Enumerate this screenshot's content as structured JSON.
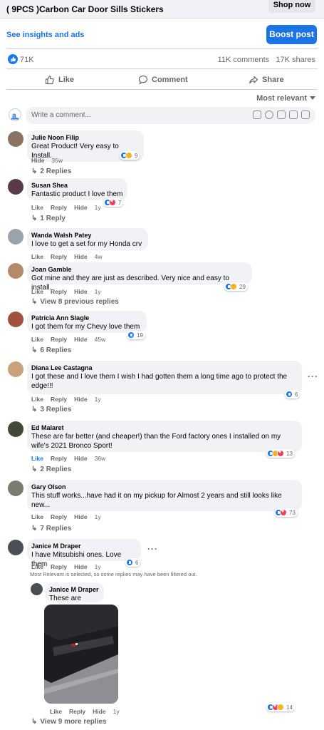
{
  "header": {
    "title": "( 9PCS )Carbon Car Door Sills Stickers",
    "shop_button": "Shop now"
  },
  "promo": {
    "insights_link": "See insights and ads",
    "boost_button": "Boost post"
  },
  "stats": {
    "reactions": "71K",
    "comments": "11K comments",
    "shares": "17K shares"
  },
  "actions": {
    "like": "Like",
    "comment": "Comment",
    "share": "Share"
  },
  "sort": {
    "label": "Most relevant"
  },
  "composer": {
    "placeholder": "Write a comment..."
  },
  "labels": {
    "like": "Like",
    "reply": "Reply",
    "hide": "Hide"
  },
  "comments": [
    {
      "name": "Julie Noon Filip",
      "text": "Great Product! Very easy to Install.",
      "time": "35w",
      "reactions": "9",
      "replies": "2 Replies"
    },
    {
      "name": "Susan Shea",
      "text": "Fantastic product I love them",
      "time": "1y",
      "reactions": "7",
      "replies": "1 Reply"
    },
    {
      "name": "Wanda Walsh Patey",
      "text": "I love to get a set for my Honda crv",
      "time": "4w"
    },
    {
      "name": "Joan Gamble",
      "text": "Got mine and they are just as described. Very nice and easy to install.",
      "time": "1y",
      "reactions": "29",
      "replies": "View 8 previous replies"
    },
    {
      "name": "Patricia Ann Slagle",
      "text": "I got them for my Chevy love them",
      "time": "45w",
      "reactions": "19",
      "replies": "6 Replies"
    },
    {
      "name": "Diana Lee Castagna",
      "text": "I got these and I love them I wish I had gotten them a long time ago to protect the edge!!!",
      "time": "1y",
      "reactions": "6",
      "replies": "3 Replies"
    },
    {
      "name": "Ed Malaret",
      "text": "These are far better (and cheaper!) than the Ford factory ones I installed on my wife's 2021 Bronco Sport!",
      "time": "36w",
      "reactions": "13",
      "replies": "2 Replies"
    },
    {
      "name": "Gary Olson",
      "text": "This stuff works...have had it on my pickup for Almost 2 years and still looks like new...",
      "time": "1y",
      "reactions": "73",
      "replies": "7 Replies"
    },
    {
      "name": "Janice M Draper",
      "text": "I have Mitsubishi ones. Love them",
      "time": "1y",
      "reactions": "6"
    }
  ],
  "filter_note": "Most Relevant is selected, so some replies may have been filtered out.",
  "reply": {
    "name": "Janice M Draper",
    "text": "These are great.",
    "time": "1y",
    "reactions": "14",
    "more": "View 9 more replies"
  },
  "colors": {
    "accent": "#1b74e4",
    "bubble": "#f0f2f5",
    "muted": "#65676b",
    "like": "#1877f2",
    "love": "#f33e58",
    "haha": "#f7b125"
  }
}
